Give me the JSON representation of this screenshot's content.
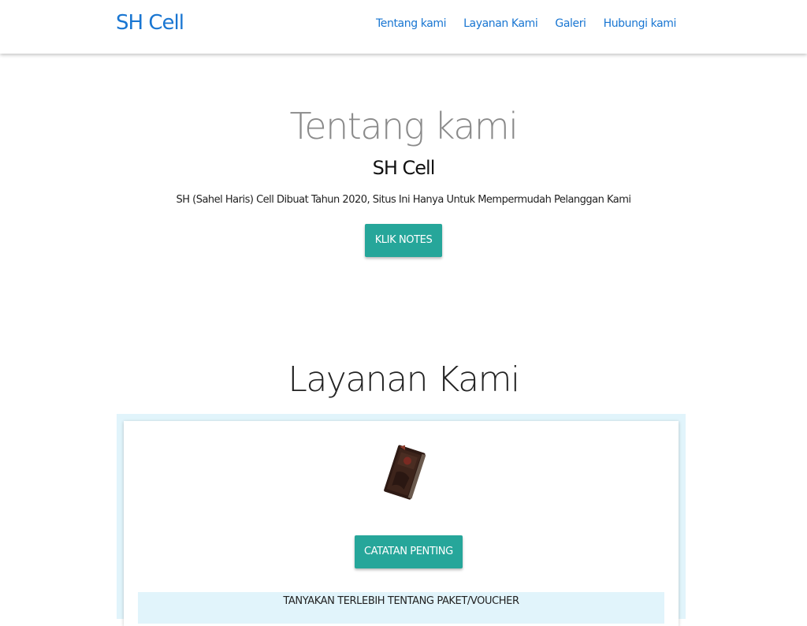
{
  "navbar": {
    "brand": "SH Cell",
    "links": [
      "Tentang kami",
      "Layanan Kami",
      "Galeri",
      "Hubungi kami"
    ]
  },
  "about": {
    "title": "Tentang kami",
    "subtitle": "SH Cell",
    "description": "SH (Sahel Haris) Cell Dibuat Tahun 2020, Situs Ini Hanya Untuk Mempermudah Pelanggan Kami",
    "button_label": "KLIK NOTES"
  },
  "services": {
    "title": "Layanan Kami",
    "card": {
      "image_icon": "book-icon",
      "button_label": "CATATAN PENTING",
      "strip_text": "TANYAKAN TERLEBIH TENTANG PAKET/VOUCHER"
    }
  },
  "colors": {
    "brand_blue": "#1976d2",
    "teal_button": "#26a69a",
    "light_blue_panel": "#e1f4fb"
  }
}
